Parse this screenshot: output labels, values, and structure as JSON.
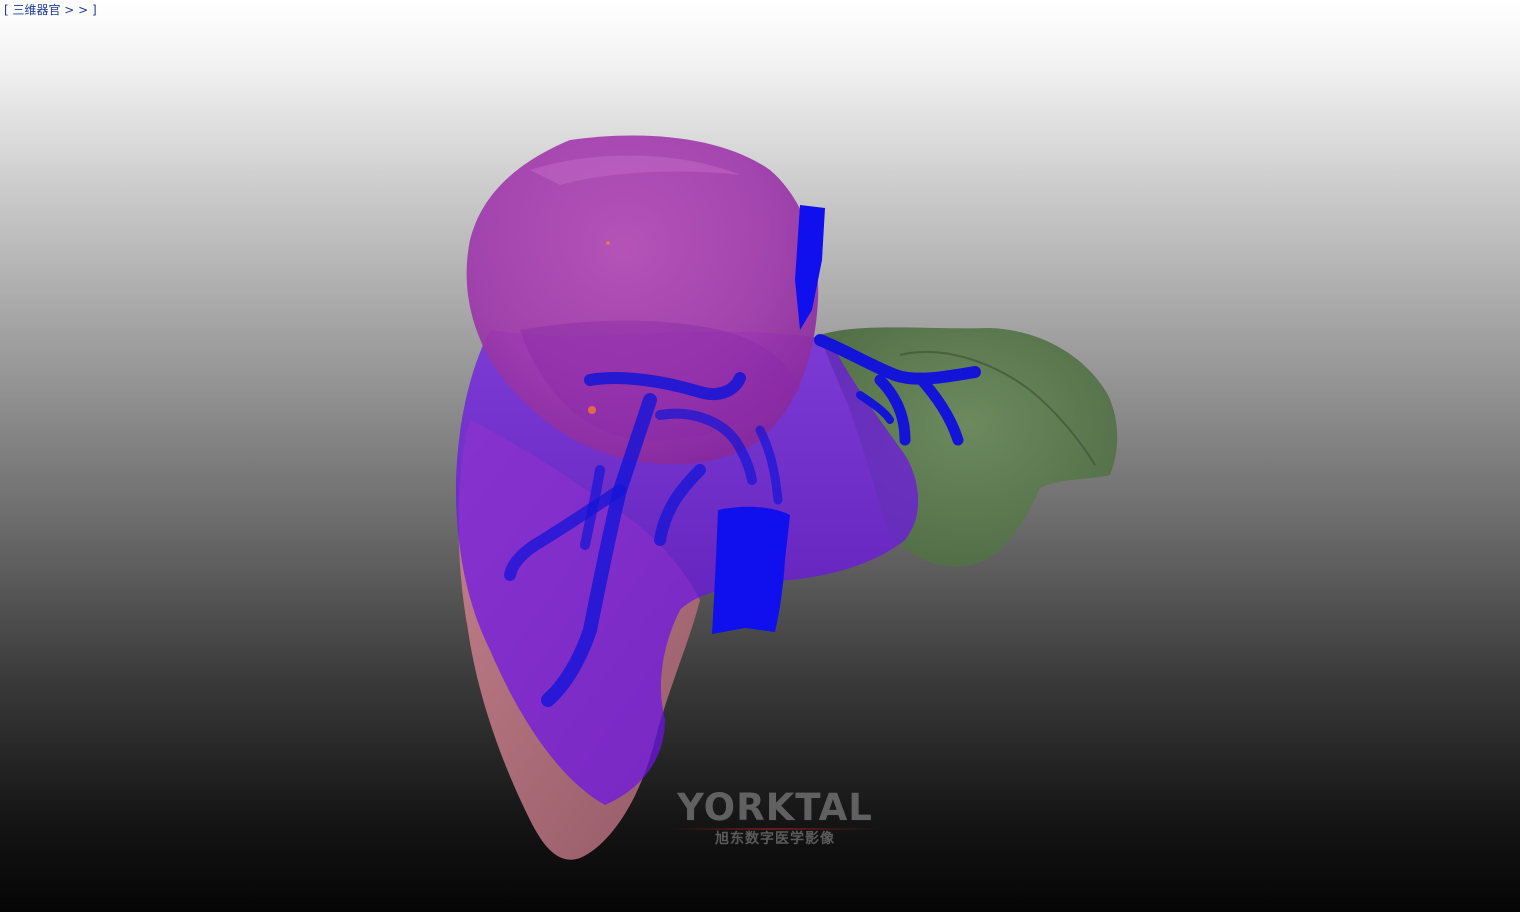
{
  "nav": {
    "organs_link": "[ 三维器官 > > ]"
  },
  "viewer": {
    "model_parts": [
      {
        "name": "liver-right-lobe",
        "color": "#9a2ab0"
      },
      {
        "name": "liver-left-lobe",
        "color": "#5e7a52"
      },
      {
        "name": "liver-posterior-surface",
        "color": "#b06a78"
      },
      {
        "name": "hepatic-veins",
        "color": "#1010ee"
      },
      {
        "name": "translucent-segment",
        "color": "#7a1aee"
      }
    ]
  },
  "watermark": {
    "brand": "YORKTAL",
    "subtitle": "旭东数字医学影像"
  }
}
